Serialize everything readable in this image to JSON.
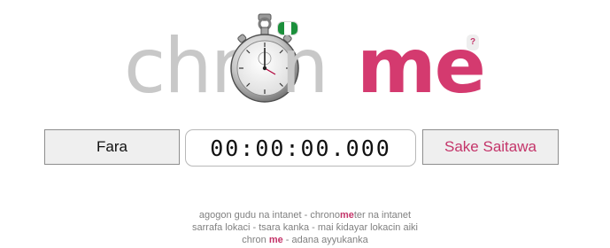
{
  "logo": {
    "part1": "chr",
    "part2": "n",
    "part3": "me",
    "colors": {
      "grey": "#c8c8c8",
      "accent": "#d43a6f"
    },
    "icons": [
      "stopwatch-icon",
      "flag-icon"
    ]
  },
  "help": {
    "label": "?"
  },
  "controls": {
    "start_label": "Fara",
    "timer_value": "00:00:00.000",
    "split_label": "Sake Saitawa"
  },
  "footer": {
    "line1_a": "agogon gudu na intanet",
    "line1_sep": " - ",
    "line1_b_pre": "chrono",
    "line1_b_hl": "me",
    "line1_b_post": "ter na intanet",
    "line2_a": "sarrafa lokaci",
    "line2_sep1": " - ",
    "line2_b": "tsara kanka",
    "line2_sep2": " - ",
    "line2_c": "mai ƙidayar lokacin aiki",
    "line3_pre": "chron ",
    "line3_hl": "me",
    "line3_sep": " - ",
    "line3_b": "adana ayyukanka"
  }
}
